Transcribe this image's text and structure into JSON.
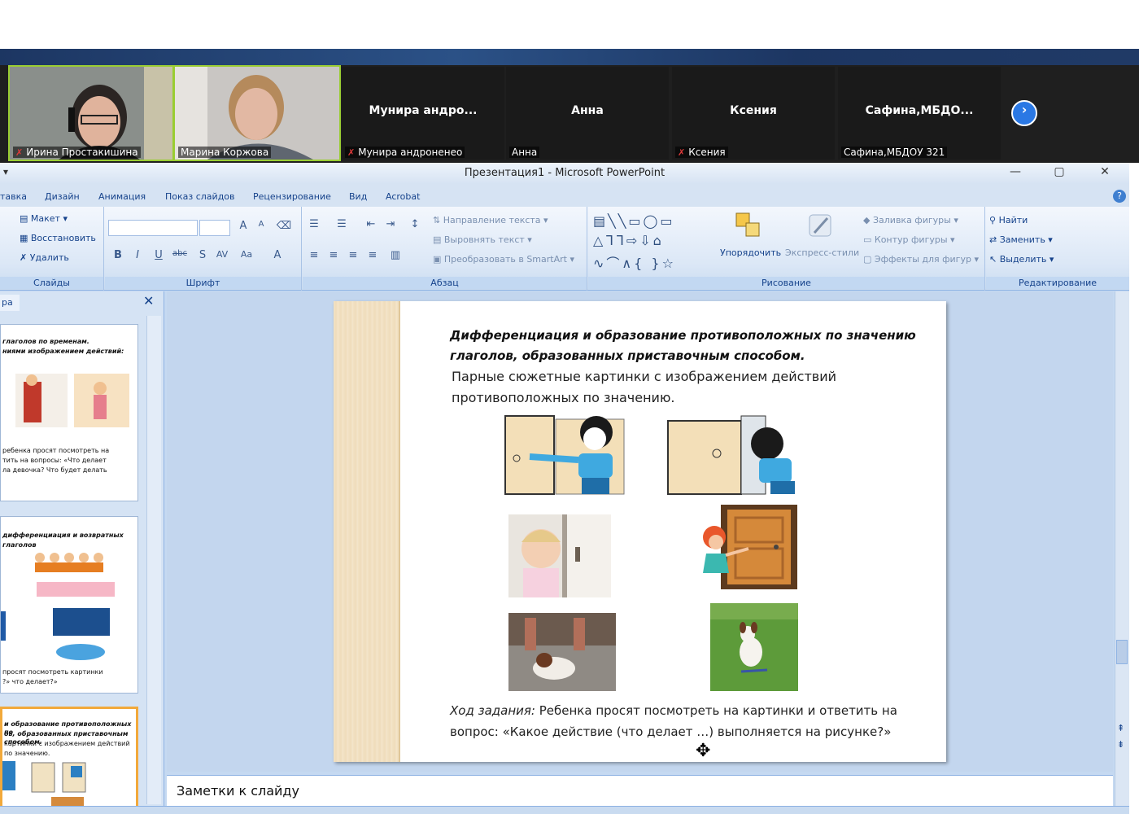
{
  "zoom": {
    "participants": [
      {
        "display_name": "",
        "caption": "Ирина Простакишина",
        "muted": true,
        "has_video": true
      },
      {
        "display_name": "",
        "caption": "Марина Коржова",
        "muted": false,
        "has_video": true
      },
      {
        "display_name": "Мунира  андро...",
        "caption": "Мунира андроненео",
        "muted": true,
        "has_video": false
      },
      {
        "display_name": "Анна",
        "caption": "Анна",
        "muted": false,
        "has_video": false
      },
      {
        "display_name": "Ксения",
        "caption": "Ксения",
        "muted": true,
        "has_video": false
      },
      {
        "display_name": "Сафина,МБДО...",
        "caption": "Сафина,МБДОУ 321",
        "muted": false,
        "has_video": false
      }
    ],
    "next_icon": "chevron-right-icon",
    "mic_icon": "muted-mic-icon"
  },
  "window": {
    "title": "Презентация1 - Microsoft PowerPoint",
    "minimize": "—",
    "restore": "▢",
    "close": "✕"
  },
  "tabs": [
    "тавка",
    "Дизайн",
    "Анимация",
    "Показ слайдов",
    "Рецензирование",
    "Вид",
    "Acrobat"
  ],
  "ribbon": {
    "slides": {
      "label": "Слайды",
      "items": [
        "Макет",
        "Восстановить",
        "Удалить"
      ]
    },
    "font": {
      "label": "Шрифт"
    },
    "paragraph": {
      "label": "Абзац",
      "items": [
        "Направление текста",
        "Выровнять текст",
        "Преобразовать в SmartArt"
      ]
    },
    "drawing": {
      "label": "Рисование",
      "items": [
        "Упорядочить",
        "Экспресс-стили",
        "Заливка фигуры",
        "Контур фигуры",
        "Эффекты для фигур"
      ]
    },
    "editing": {
      "label": "Редактирование",
      "items": [
        "Найти",
        "Заменить",
        "Выделить"
      ]
    }
  },
  "sidepanel": {
    "tab_label": "ра",
    "close": "✕",
    "thumb1": {
      "lines": [
        "глаголов по временам.",
        "ниями изображением действий:"
      ],
      "body": [
        "ребенка просят посмотреть на",
        "тить на вопросы: «Что делает",
        "ла девочка? Что будет делать"
      ]
    },
    "thumb2": {
      "lines": [
        "дифференциация и возвратных",
        "глаголов"
      ],
      "body": [
        "просят посмотреть картинки",
        "?» что делает?»"
      ]
    },
    "thumb3": {
      "lines": [
        "и образование противоположных по",
        "ов, образованных приставочным способом.",
        "картинки с изображением действий",
        "по значению."
      ]
    }
  },
  "slide": {
    "title": "Дифференциация и образование противоположных по значению глаголов, образованных приставочным способом.",
    "subtitle": "Парные сюжетные картинки с изображением действий противоположных по значению.",
    "task_label": "Ход задания:",
    "task_text": " Ребенка просят посмотреть на картинки и ответить на вопрос: «Какое действие (что делает …) выполняется на рисунке?»"
  },
  "notes": {
    "placeholder": "Заметки к слайду"
  },
  "colors": {
    "zoom_bg": "#1f1f1f",
    "ribbon_text": "#15428b",
    "accent": "#2a78e4",
    "selected_thumb": "#f2a93b"
  }
}
